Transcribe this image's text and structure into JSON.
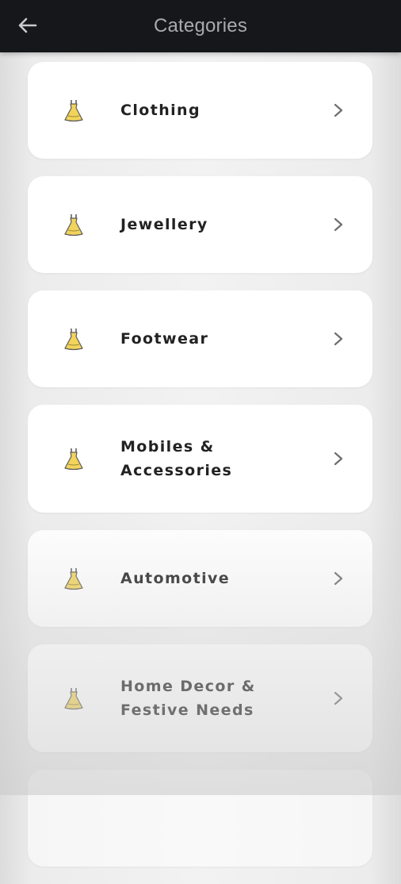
{
  "app_bar": {
    "title": "Categories",
    "back_icon": "arrow-left-icon"
  },
  "categories": [
    {
      "label": "Clothing",
      "icon": "dress-icon"
    },
    {
      "label": "Jewellery",
      "icon": "dress-icon"
    },
    {
      "label": "Footwear",
      "icon": "dress-icon"
    },
    {
      "label": "Mobiles & Accessories",
      "icon": "dress-icon"
    },
    {
      "label": "Automotive",
      "icon": "dress-icon"
    },
    {
      "label": "Home Decor & Festive Needs",
      "icon": "dress-icon"
    }
  ],
  "colors": {
    "app_bar_bg": "#16171b",
    "title": "#a8aab0",
    "card_bg": "#ffffff",
    "icon_fill": "#f2d45c",
    "text": "#222222",
    "chevron": "#6e6e6e"
  }
}
